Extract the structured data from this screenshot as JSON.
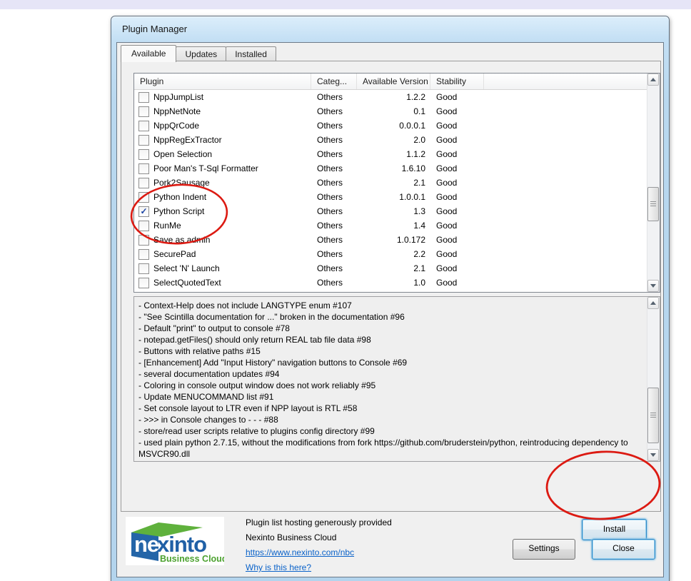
{
  "page": {
    "top_band_color": "#e6e5f7"
  },
  "window": {
    "title": "Plugin Manager",
    "tabs": [
      {
        "label": "Available",
        "active": true
      },
      {
        "label": "Updates",
        "active": false
      },
      {
        "label": "Installed",
        "active": false
      }
    ]
  },
  "plugin_table": {
    "columns": [
      "Plugin",
      "Categ...",
      "Available Version",
      "Stability"
    ],
    "rows": [
      {
        "checked": false,
        "name": "NppJumpList",
        "category": "Others",
        "version": "1.2.2",
        "stability": "Good"
      },
      {
        "checked": false,
        "name": "NppNetNote",
        "category": "Others",
        "version": "0.1",
        "stability": "Good"
      },
      {
        "checked": false,
        "name": "NppQrCode",
        "category": "Others",
        "version": "0.0.0.1",
        "stability": "Good"
      },
      {
        "checked": false,
        "name": "NppRegExTractor",
        "category": "Others",
        "version": "2.0",
        "stability": "Good"
      },
      {
        "checked": false,
        "name": "Open Selection",
        "category": "Others",
        "version": "1.1.2",
        "stability": "Good"
      },
      {
        "checked": false,
        "name": "Poor Man's T-Sql Formatter",
        "category": "Others",
        "version": "1.6.10",
        "stability": "Good"
      },
      {
        "checked": false,
        "name": "Pork2Sausage",
        "category": "Others",
        "version": "2.1",
        "stability": "Good"
      },
      {
        "checked": false,
        "name": "Python Indent",
        "category": "Others",
        "version": "1.0.0.1",
        "stability": "Good"
      },
      {
        "checked": true,
        "name": "Python Script",
        "category": "Others",
        "version": "1.3",
        "stability": "Good"
      },
      {
        "checked": false,
        "name": "RunMe",
        "category": "Others",
        "version": "1.4",
        "stability": "Good"
      },
      {
        "checked": false,
        "name": "Save as admin",
        "category": "Others",
        "version": "1.0.172",
        "stability": "Good"
      },
      {
        "checked": false,
        "name": "SecurePad",
        "category": "Others",
        "version": "2.2",
        "stability": "Good"
      },
      {
        "checked": false,
        "name": "Select 'N' Launch",
        "category": "Others",
        "version": "2.1",
        "stability": "Good"
      },
      {
        "checked": false,
        "name": "SelectQuotedText",
        "category": "Others",
        "version": "1.0",
        "stability": "Good"
      }
    ]
  },
  "description": {
    "lines": [
      "- Context-Help does not include LANGTYPE enum #107",
      "- \"See Scintilla documentation for ...\" broken in the documentation #96",
      "- Default \"print\" to output to console #78",
      "- notepad.getFiles() should only return REAL tab file data #98",
      "- Buttons with relative paths #15",
      "- [Enhancement] Add \"Input History\" navigation buttons to Console #69",
      "- several documentation updates #94",
      "- Coloring in console output window does not work reliably #95",
      "- Update MENUCOMMAND list #91",
      "- Set console layout to LTR even if NPP layout is RTL #58",
      "- >>> in Console changes to - - - #88",
      "- store/read user scripts relative to plugins config directory #99",
      "- used plain python 2.7.15, without the modifications from fork https://github.com/bruderstein/python, reintroducing dependency to MSVCR90.dll"
    ]
  },
  "actions": {
    "install": "Install",
    "settings": "Settings",
    "close": "Close"
  },
  "footer": {
    "provider_line": "Plugin list hosting generously provided",
    "provider_name": "Nexinto Business Cloud",
    "provider_url": "https://www.nexinto.com/nbc",
    "why_link": "Why is this here?",
    "logo": {
      "brand_prefix": "ne",
      "brand_suffix": "xinto",
      "tagline": "Business Cloud"
    }
  },
  "colors": {
    "annotation_red": "#dc1a12",
    "link_blue": "#0a62c9",
    "checkmark_blue": "#1c45a5",
    "logo_blue": "#2060a6",
    "logo_green": "#55aa33",
    "top_band": "#e6e5f7"
  }
}
